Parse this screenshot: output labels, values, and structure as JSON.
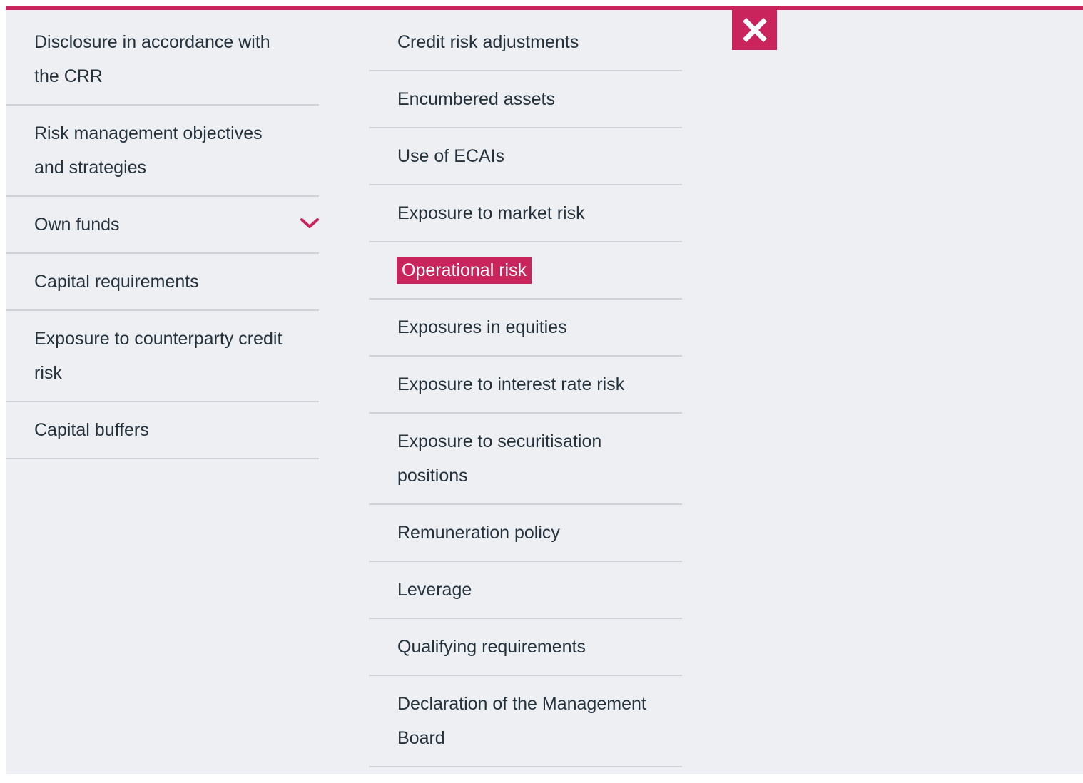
{
  "accent_color": "#c9245c",
  "close_button": {
    "icon": "close-icon"
  },
  "left_menu": {
    "items": [
      {
        "label": "Disclosure in accordance with the CRR"
      },
      {
        "label": "Risk management objectives and strategies"
      },
      {
        "label": "Own funds",
        "icon": "chevron-down-icon"
      },
      {
        "label": "Capital requirements"
      },
      {
        "label": "Exposure to counterparty credit risk"
      },
      {
        "label": "Capital buffers"
      }
    ]
  },
  "right_menu": {
    "items": [
      {
        "label": "Credit risk adjustments"
      },
      {
        "label": "Encumbered assets"
      },
      {
        "label": "Use of ECAIs"
      },
      {
        "label": "Exposure to market risk"
      },
      {
        "label": "Operational risk",
        "active": true
      },
      {
        "label": "Exposures in equities"
      },
      {
        "label": "Exposure to interest rate risk"
      },
      {
        "label": "Exposure to securitisation positions"
      },
      {
        "label": "Remuneration policy"
      },
      {
        "label": "Leverage"
      },
      {
        "label": "Qualifying requirements"
      },
      {
        "label": "Declaration of the Management Board"
      }
    ]
  }
}
